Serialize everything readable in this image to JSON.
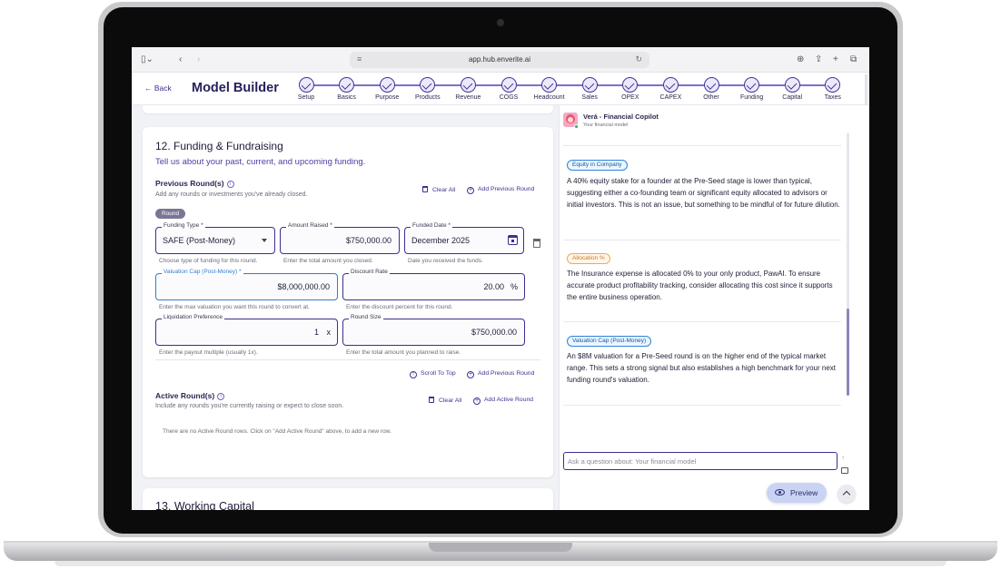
{
  "browser": {
    "url": "app.hub.enverite.ai"
  },
  "header": {
    "back_label": "Back",
    "title": "Model Builder",
    "steps": [
      {
        "label": "Setup"
      },
      {
        "label": "Basics"
      },
      {
        "label": "Purpose"
      },
      {
        "label": "Products"
      },
      {
        "label": "Revenue"
      },
      {
        "label": "COGS"
      },
      {
        "label": "Headcount"
      },
      {
        "label": "Sales"
      },
      {
        "label": "OPEX"
      },
      {
        "label": "CAPEX"
      },
      {
        "label": "Other"
      },
      {
        "label": "Funding"
      },
      {
        "label": "Capital"
      },
      {
        "label": "Taxes"
      }
    ],
    "step_state": "completed"
  },
  "section": {
    "title": "12. Funding & Fundraising",
    "subtitle": "Tell us about your past, current, and upcoming funding.",
    "previous": {
      "heading": "Previous Round(s)",
      "description": "Add any rounds or investments you've already closed.",
      "clear_all": "Clear All",
      "add_label": "Add Previous Round",
      "tag": "Round",
      "fields": {
        "funding_type": {
          "label": "Funding Type *",
          "value": "SAFE (Post-Money)",
          "help": "Choose type of funding for this round."
        },
        "amount_raised": {
          "label": "Amount Raised *",
          "value": "$750,000.00",
          "help": "Enter the total amount you closed."
        },
        "funded_date": {
          "label": "Funded Date *",
          "value": "December 2025",
          "help": "Date you received the funds."
        },
        "valuation_cap": {
          "label": "Valuation Cap (Post-Money) *",
          "value": "$8,000,000.00",
          "help": "Enter the max valuation you want this round to convert at."
        },
        "discount_rate": {
          "label": "Discount Rate",
          "value": "20.00",
          "suffix": "%",
          "help": "Enter the discount percent for this round."
        },
        "liquidation_pref": {
          "label": "Liquidation Preference",
          "value": "1",
          "suffix": "x",
          "help": "Enter the payout multiple (usually 1x)."
        },
        "round_size": {
          "label": "Round Size",
          "value": "$750,000.00",
          "help": "Enter the total amount you planned to raise."
        }
      },
      "scroll_top": "Scroll To Top",
      "add_bottom": "Add Previous Round"
    },
    "active": {
      "heading": "Active Round(s)",
      "description": "Include any rounds you're currently raising or expect to close soon.",
      "clear_all": "Clear All",
      "add_label": "Add Active Round",
      "empty": "There are no Active Round rows. Click on \"Add Active Round\" above, to add a new row."
    }
  },
  "next_section": {
    "title": "13. Working Capital"
  },
  "copilot": {
    "name": "Verá - Financial Copilot",
    "subtitle": "Your financial model",
    "messages": [
      {
        "tag": "Equity in Company",
        "tag_color": "#2f84d6",
        "text": "A 40% equity stake for a founder at the Pre-Seed stage is lower than typical, suggesting either a co-founding team or significant equity allocated to advisors or initial investors. This is not an issue, but something to be mindful of for future dilution."
      },
      {
        "tag": "Allocation %",
        "tag_color": "#f2a94e",
        "text": "The Insurance expense is allocated 0% to your only product, PawAI. To ensure accurate product profitability tracking, consider allocating this cost since it supports the entire business operation."
      },
      {
        "tag": "Valuation Cap (Post-Money)",
        "tag_color": "#2f84d6",
        "text": "An $8M valuation for a Pre-Seed round is on the higher end of the typical market range. This sets a strong signal but also establishes a high benchmark for your next funding round's valuation."
      }
    ],
    "input_placeholder": "Ask a question about: Your financial model",
    "preview_label": "Preview"
  },
  "colors": {
    "primary": "#3b2f8f",
    "title": "#25205b",
    "focus": "#2f7bd3"
  }
}
